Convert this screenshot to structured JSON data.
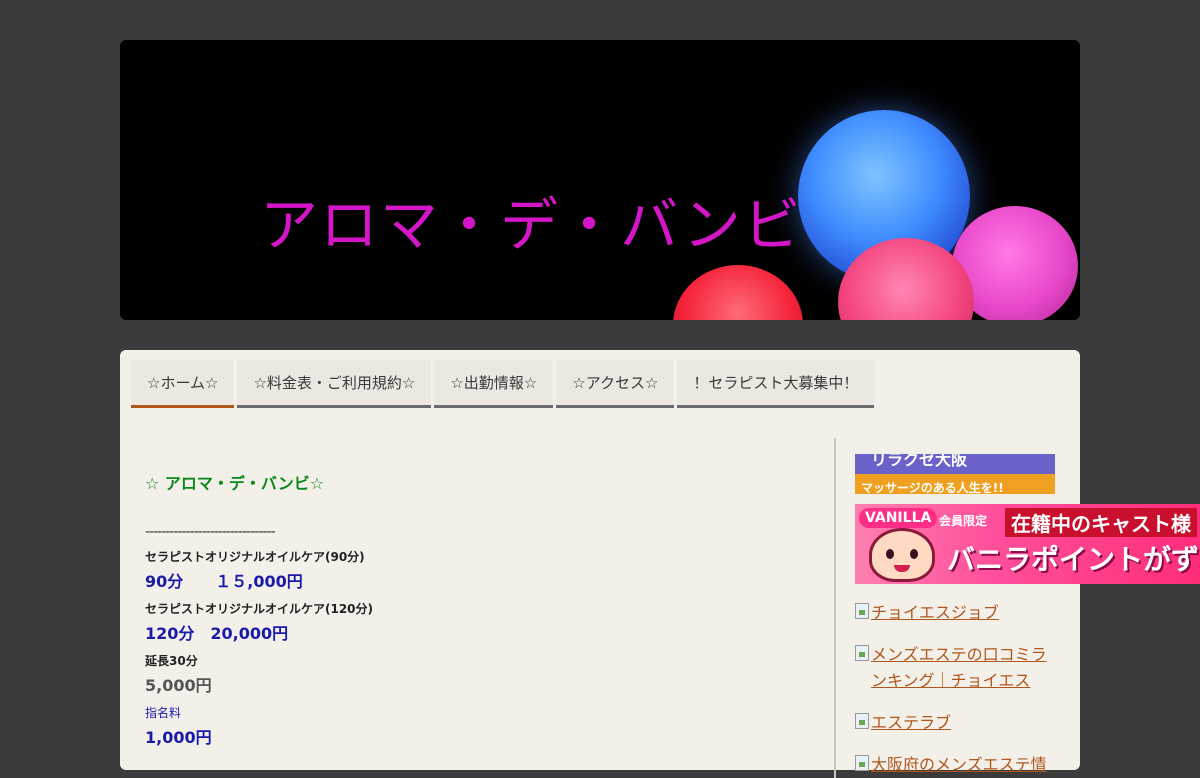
{
  "header": {
    "site_title": "アロマ・デ・バンビ"
  },
  "nav": {
    "items": [
      {
        "label": "☆ホーム☆",
        "active": true
      },
      {
        "label": "☆料金表・ご利用規約☆",
        "active": false
      },
      {
        "label": "☆出勤情報☆",
        "active": false
      },
      {
        "label": "☆アクセス☆",
        "active": false
      },
      {
        "label": "！セラピスト大募集中！",
        "active": false
      }
    ]
  },
  "main": {
    "heading": "☆ アロマ・デ・バンビ☆",
    "separator": "--------------------------------",
    "course1_label": "セラピストオリジナルオイルケア(90分)",
    "course1_price": "90分　　１５,000円",
    "course2_label": "セラピストオリジナルオイルケア(120分)",
    "course2_price": "120分　20,000円",
    "extension_label": "延長30分",
    "extension_price": "5,000円",
    "nomination_label": "指名料",
    "nomination_price": "1,000円"
  },
  "sidebar": {
    "banner1_top": "リラクゼ大阪",
    "banner1_bottom": "マッサージのある人生を!!",
    "banner2_logo": "VANILLA",
    "banner2_badge": "会員限定",
    "banner2_line1": "在籍中のキャスト様",
    "banner2_line2": "バニラポイントがず",
    "links": [
      "チョイエスジョブ",
      "メンズエステの口コミランキング｜チョイエス",
      "エステラブ",
      "大阪府のメンズエステ情"
    ]
  },
  "colors": {
    "background": "#3b3b3b",
    "title_magenta": "#d416c8",
    "content_bg": "#f3efe9",
    "heading_green": "#0a8a1c",
    "price_blue": "#1a1aa8",
    "link_orange": "#b0571b",
    "nav_active_underline": "#b0571b"
  },
  "icons": [
    "broken-image-icon"
  ]
}
